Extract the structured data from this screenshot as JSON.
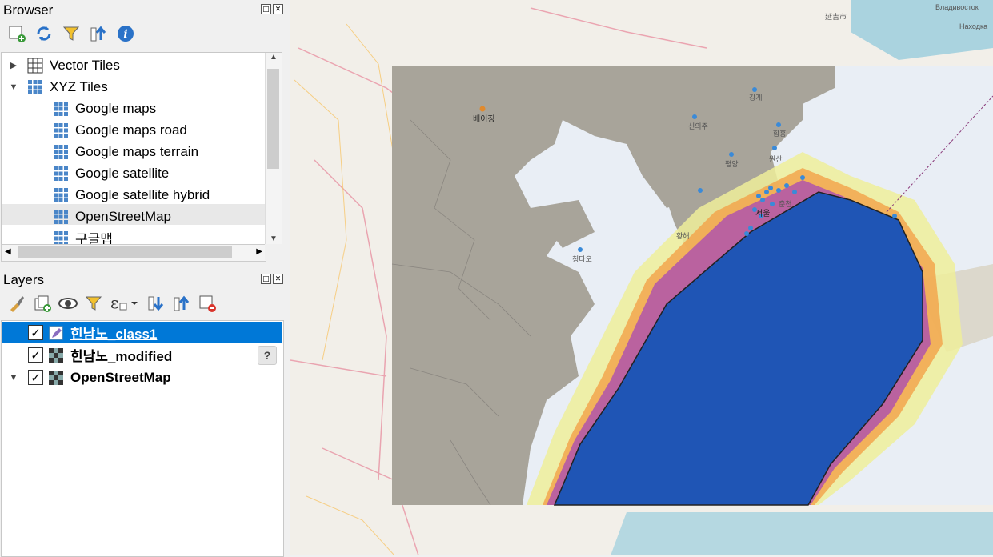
{
  "browser": {
    "title": "Browser",
    "items": [
      {
        "label": "Vector Tiles",
        "expanded": false
      },
      {
        "label": "XYZ Tiles",
        "expanded": true
      },
      {
        "label": "Google maps"
      },
      {
        "label": "Google maps road"
      },
      {
        "label": "Google maps terrain"
      },
      {
        "label": "Google satellite"
      },
      {
        "label": "Google satellite hybrid"
      },
      {
        "label": "OpenStreetMap"
      },
      {
        "label": "구글맵"
      }
    ]
  },
  "layers": {
    "title": "Layers",
    "items": [
      {
        "label": "힌남노_class1",
        "checked": true,
        "selected": true
      },
      {
        "label": "힌남노_modified",
        "checked": true
      },
      {
        "label": "OpenStreetMap",
        "checked": true
      }
    ]
  },
  "map": {
    "labels": {
      "beijing": "베이징",
      "seoul": "서울",
      "gangye": "강계",
      "sinuiju": "신의주",
      "hamhung": "함흥",
      "pyongyang": "평양",
      "wonsan": "원산",
      "chuncheon": "춘천",
      "qingdao": "칭다오",
      "vladivostok": "Владивосток",
      "yanji": "延吉市",
      "nakhodka": "Находка",
      "yellowsea": "황해"
    },
    "colors": {
      "typhoon_core": "#1f55b5",
      "band_purple": "#b45aa6",
      "band_orange": "#f2a64d",
      "band_yellow": "#eeee9a",
      "land": "#f2efe9",
      "sea": "#aad3df",
      "raster_land": "#a8a49a",
      "raster_sea": "#e9eef5"
    }
  }
}
